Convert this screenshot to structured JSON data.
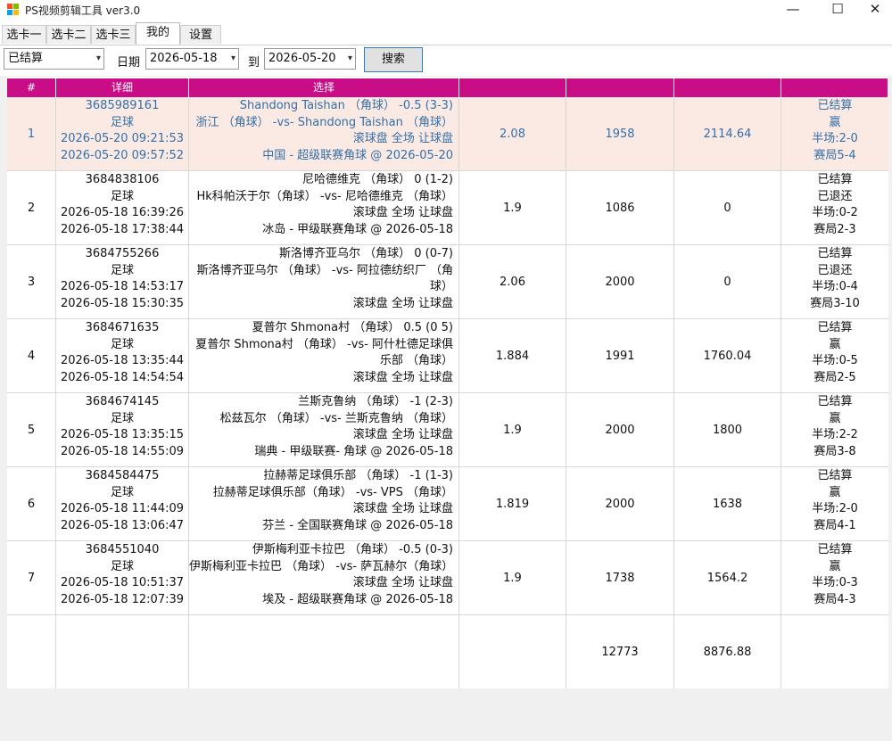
{
  "window": {
    "title": "PS视频剪辑工具 ver3.0",
    "minimize": "—",
    "maximize": "☐",
    "close": "✕"
  },
  "tabs": [
    {
      "label": "选卡一"
    },
    {
      "label": "选卡二"
    },
    {
      "label": "选卡三"
    },
    {
      "label": "我的",
      "active": true
    },
    {
      "label": "设置"
    }
  ],
  "toolbar": {
    "status_value": "已结算",
    "date_label": "日期",
    "date_from": "2026-05-18",
    "to_label": "到",
    "date_to": "2026-05-20",
    "search_label": "搜索"
  },
  "table": {
    "headers": [
      "#",
      "详细",
      "选择",
      "",
      "",
      "",
      ""
    ],
    "rows": [
      {
        "no": "1",
        "id": "3685989161",
        "sport": "足球",
        "time1": "2026-05-20 09:21:53",
        "time2": "2026-05-20 09:57:52",
        "sel": [
          "Shandong Taishan （角球） -0.5 (3-3)",
          "浙江 （角球） -vs- Shandong Taishan （角球）",
          "滚球盘 全场 让球盘",
          "中国 - 超级联赛角球 @ 2026-05-20"
        ],
        "odds": "2.08",
        "stake": "1958",
        "payout": "2114.64",
        "result": [
          "已结算",
          "赢",
          "半场:2-0",
          "赛局5-4"
        ]
      },
      {
        "no": "2",
        "id": "3684838106",
        "sport": "足球",
        "time1": "2026-05-18 16:39:26",
        "time2": "2026-05-18 17:38:44",
        "sel": [
          "尼哈德维克 （角球） 0 (1-2)",
          "Hk科帕沃于尔（角球） -vs- 尼哈德维克 （角球）",
          "滚球盘 全场 让球盘",
          "冰岛 - 甲级联赛角球 @ 2026-05-18"
        ],
        "odds": "1.9",
        "stake": "1086",
        "payout": "0",
        "result": [
          "已结算",
          "已退还",
          "半场:0-2",
          "赛局2-3"
        ]
      },
      {
        "no": "3",
        "id": "3684755266",
        "sport": "足球",
        "time1": "2026-05-18 14:53:17",
        "time2": "2026-05-18 15:30:35",
        "sel": [
          "斯洛博齐亚乌尔 （角球） 0 (0-7)",
          "斯洛博齐亚乌尔 （角球） -vs- 阿拉德纺织厂 （角",
          "球）",
          "滚球盘 全场 让球盘"
        ],
        "odds": "2.06",
        "stake": "2000",
        "payout": "0",
        "result": [
          "已结算",
          "已退还",
          "半场:0-4",
          "赛局3-10"
        ]
      },
      {
        "no": "4",
        "id": "3684671635",
        "sport": "足球",
        "time1": "2026-05-18 13:35:44",
        "time2": "2026-05-18 14:54:54",
        "sel": [
          "夏普尔 Shmona村 （角球） 0.5 (0 5)",
          "夏普尔 Shmona村 （角球） -vs- 阿什杜德足球俱",
          "乐部 （角球）",
          "滚球盘 全场 让球盘"
        ],
        "odds": "1.884",
        "stake": "1991",
        "payout": "1760.04",
        "result": [
          "已结算",
          "赢",
          "半场:0-5",
          "赛局2-5"
        ]
      },
      {
        "no": "5",
        "id": "3684674145",
        "sport": "足球",
        "time1": "2026-05-18 13:35:15",
        "time2": "2026-05-18 14:55:09",
        "sel": [
          "兰斯克鲁纳 （角球） -1 (2-3)",
          "松兹瓦尔 （角球） -vs- 兰斯克鲁纳 （角球）",
          "滚球盘 全场 让球盘",
          "瑞典 - 甲级联赛- 角球 @ 2026-05-18"
        ],
        "odds": "1.9",
        "stake": "2000",
        "payout": "1800",
        "result": [
          "已结算",
          "赢",
          "半场:2-2",
          "赛局3-8"
        ]
      },
      {
        "no": "6",
        "id": "3684584475",
        "sport": "足球",
        "time1": "2026-05-18 11:44:09",
        "time2": "2026-05-18 13:06:47",
        "sel": [
          "拉赫蒂足球俱乐部 （角球） -1 (1-3)",
          "拉赫蒂足球俱乐部（角球） -vs- VPS （角球）",
          "滚球盘 全场 让球盘",
          "芬兰 - 全国联赛角球 @ 2026-05-18"
        ],
        "odds": "1.819",
        "stake": "2000",
        "payout": "1638",
        "result": [
          "已结算",
          "赢",
          "半场:2-0",
          "赛局4-1"
        ]
      },
      {
        "no": "7",
        "id": "3684551040",
        "sport": "足球",
        "time1": "2026-05-18 10:51:37",
        "time2": "2026-05-18 12:07:39",
        "sel": [
          "伊斯梅利亚卡拉巴 （角球） -0.5 (0-3)",
          "伊斯梅利亚卡拉巴 （角球） -vs- 萨瓦赫尔（角球）",
          "滚球盘 全场 让球盘",
          "埃及 - 超级联赛角球 @ 2026-05-18"
        ],
        "odds": "1.9",
        "stake": "1738",
        "payout": "1564.2",
        "result": [
          "已结算",
          "赢",
          "半场:0-3",
          "赛局4-3"
        ]
      }
    ],
    "totals": {
      "stake": "12773",
      "payout": "8876.88"
    }
  }
}
